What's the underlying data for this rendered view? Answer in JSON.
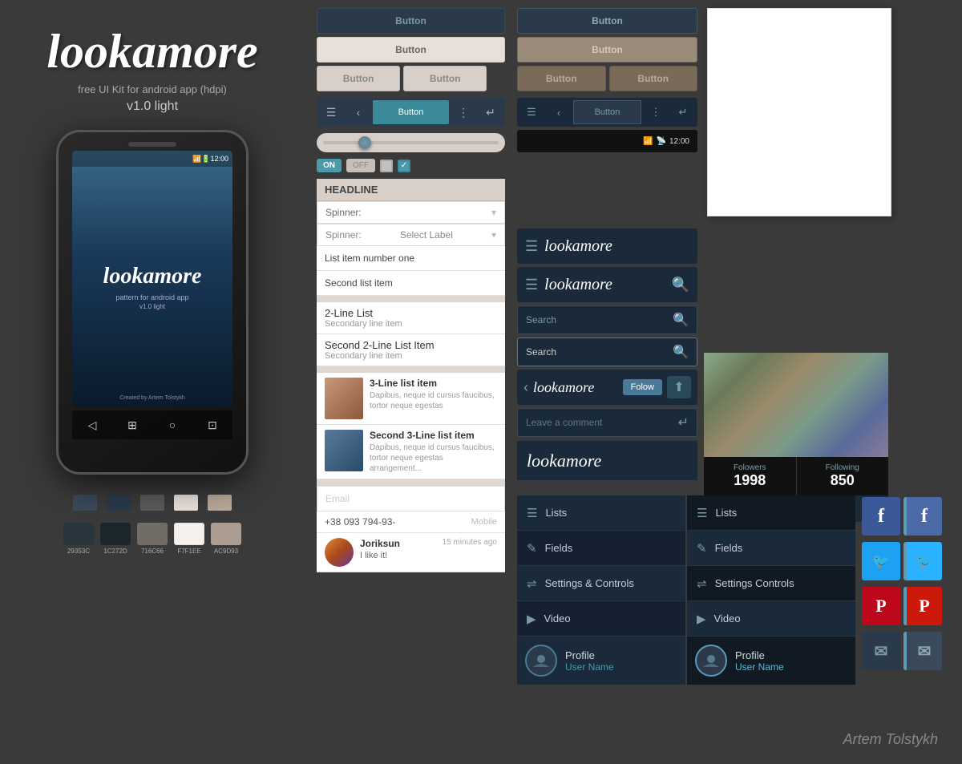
{
  "brand": {
    "logo": "lookamore",
    "tagline": "free UI Kit for android app (hdpi)",
    "version": "v1.0 light",
    "phone_logo": "lookamore",
    "phone_tagline": "pattern for android app",
    "phone_version": "v1.0 light",
    "phone_credit": "Created by Artem Tolstykh",
    "signature": "Artem Tolstykh"
  },
  "colors": {
    "swatch1": {
      "hex": "#29353C",
      "label": "29353C"
    },
    "swatch2": {
      "hex": "#1C272D",
      "label": "1C272D"
    },
    "swatch3": {
      "hex": "#716C66",
      "label": "716C66"
    },
    "swatch4": {
      "hex": "#F7F1EE",
      "label": "F7F1EE"
    },
    "swatch5": {
      "hex": "#AC9D93",
      "label": "AC9D93"
    }
  },
  "buttons": {
    "light": {
      "primary_label": "Button",
      "secondary_label": "Button",
      "half1_label": "Button",
      "half2_label": "Button"
    },
    "dark": {
      "primary_label": "Button",
      "secondary_label": "Button",
      "half1_label": "Button",
      "half2_label": "Button"
    }
  },
  "toolbar": {
    "center_label": "Button"
  },
  "status_bar": {
    "time": "12:00"
  },
  "form": {
    "headline": "HEADLINE",
    "spinner1_label": "Spinner:",
    "spinner2_label": "Spinner:",
    "spinner2_value": "Select Label",
    "list_item1": "List item number one",
    "list_item2": "Second list item",
    "two_line1_primary": "2-Line List",
    "two_line1_secondary": "Secondary line item",
    "two_line2_primary": "Second 2-Line List Item",
    "two_line2_secondary": "Secondary line item",
    "three_line1_title": "3-Line list item",
    "three_line1_desc": "Dapibus, neque id cursus faucibus, tortor neque egestas",
    "three_line2_title": "Second 3-Line list item",
    "three_line2_desc": "Dapibus, neque id cursus faucibus, tortor neque egestas arrangement...",
    "email_placeholder": "Email",
    "phone_value": "+38 093 794-93-",
    "phone_type": "Mobile",
    "comment_author": "Joriksun",
    "comment_time": "15 minutes ago",
    "comment_text": "I like it!"
  },
  "dark_ui": {
    "app_logo": "lookamore",
    "search1_placeholder": "Search",
    "search2_placeholder": "Search",
    "follow_label": "Folow",
    "comment_placeholder": "Leave a comment",
    "brand_logo": "lookamore"
  },
  "toggle": {
    "on_label": "ON",
    "off_label": "OFF"
  },
  "menu": {
    "col1": [
      {
        "icon": "≡",
        "label": "Lists"
      },
      {
        "icon": "✎",
        "label": "Fields"
      },
      {
        "icon": "⇌",
        "label": "Settings & Controls"
      },
      {
        "icon": "▶",
        "label": "Video"
      },
      {
        "icon": "👤",
        "label": "Profile",
        "username": "User Name"
      }
    ],
    "col2": [
      {
        "icon": "≡",
        "label": "Lists"
      },
      {
        "icon": "✎",
        "label": "Fields"
      },
      {
        "icon": "⇌",
        "label": "Settings Controls"
      },
      {
        "icon": "▶",
        "label": "Video"
      },
      {
        "icon": "👤",
        "label": "Profile",
        "username": "User Name"
      }
    ]
  },
  "profile_card": {
    "followers_label": "Folowers",
    "followers_count": "1998",
    "following_label": "Following",
    "following_count": "850"
  },
  "social": {
    "facebook_icon": "f",
    "twitter_icon": "t",
    "pinterest_icon": "p",
    "mail_icon": "✉"
  }
}
